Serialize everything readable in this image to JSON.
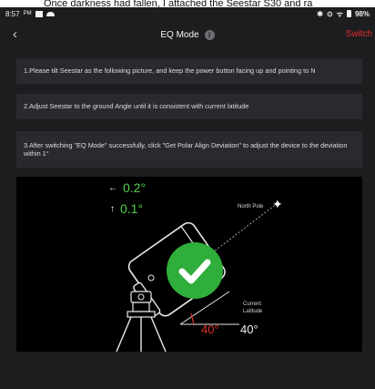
{
  "caption": "Once darkness had fallen, I attached the Seestar S30 and ra",
  "status_bar": {
    "time": "8:57",
    "ampm": "PM",
    "battery": "98%"
  },
  "header": {
    "title": "EQ Mode",
    "info_icon": "info-icon",
    "back_icon": "chevron-left-icon",
    "switch_label": "Switch"
  },
  "steps": [
    "1.Please tilt Seestar as the following picture, and keep the power button facing up and pointing to N",
    "2.Adjust Seestar to the ground Angle until it is consistent with current latitude",
    "3.After switching \"EQ Mode\" successfully, click \"Get Polar Align Deviation\" to adjust the device to the deviation within 1°"
  ],
  "illustration": {
    "horizontal_deviation": "0.2°",
    "vertical_deviation": "0.1°",
    "north_pole_label": "North Pole",
    "current_latitude_label": "Current Latitude",
    "tilt_angle": "40°",
    "current_latitude": "40°"
  },
  "colors": {
    "background": "#1d1d20",
    "card": "#2a2a2e",
    "accent_red": "#e0302c",
    "accent_green": "#4fd24a",
    "check_green": "#2fae3b"
  }
}
